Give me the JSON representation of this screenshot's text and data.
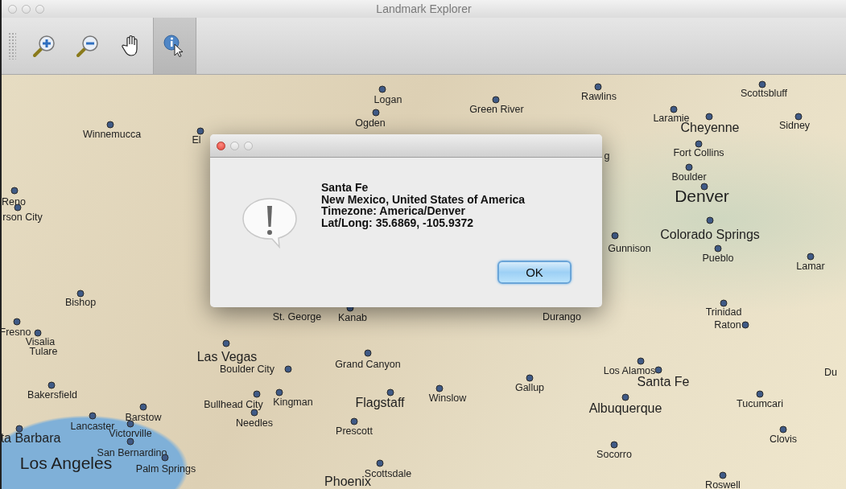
{
  "window": {
    "title": "Landmark Explorer",
    "active": false
  },
  "toolbar": {
    "tools": [
      {
        "kind": "zoom-in",
        "selected": false
      },
      {
        "kind": "zoom-out",
        "selected": false
      },
      {
        "kind": "pan",
        "selected": false
      },
      {
        "kind": "info",
        "selected": true
      }
    ]
  },
  "map": {
    "landmarks": [
      {
        "name": "Logan",
        "kind": "minor"
      },
      {
        "name": "Ogden",
        "kind": "minor"
      },
      {
        "name": "Green River",
        "kind": "minor"
      },
      {
        "name": "Rawlins",
        "kind": "minor"
      },
      {
        "name": "Scottsbluff",
        "kind": "minor"
      },
      {
        "name": "Laramie",
        "kind": "minor"
      },
      {
        "name": "Cheyenne",
        "kind": "major"
      },
      {
        "name": "Sidney",
        "kind": "minor"
      },
      {
        "name": "Fort Collins",
        "kind": "minor"
      },
      {
        "name": "Boulder",
        "kind": "minor"
      },
      {
        "name": "Denver",
        "kind": "capital"
      },
      {
        "name": "Colorado Springs",
        "kind": "major"
      },
      {
        "name": "Pueblo",
        "kind": "minor"
      },
      {
        "name": "Lamar",
        "kind": "minor"
      },
      {
        "name": "g",
        "kind": "minor"
      },
      {
        "name": "Gunnison",
        "kind": "minor"
      },
      {
        "name": "Winnemucca",
        "kind": "minor"
      },
      {
        "name": "El",
        "kind": "minor"
      },
      {
        "name": "Reno",
        "kind": "minor"
      },
      {
        "name": "rson City",
        "kind": "minor"
      },
      {
        "name": "Bishop",
        "kind": "minor"
      },
      {
        "name": "Fresno",
        "kind": "minor"
      },
      {
        "name": "Visalia",
        "kind": "minor"
      },
      {
        "name": "Tulare",
        "kind": "minor"
      },
      {
        "name": "Bakersfield",
        "kind": "minor"
      },
      {
        "name": "Barstow",
        "kind": "minor"
      },
      {
        "name": "Lancaster",
        "kind": "minor"
      },
      {
        "name": "Victorville",
        "kind": "minor"
      },
      {
        "name": "ta Barbara",
        "kind": "major"
      },
      {
        "name": "San Bernardino",
        "kind": "minor"
      },
      {
        "name": "Los Angeles",
        "kind": "capital"
      },
      {
        "name": "Palm Springs",
        "kind": "minor"
      },
      {
        "name": "St. George",
        "kind": "minor"
      },
      {
        "name": "Kanab",
        "kind": "minor"
      },
      {
        "name": "Durango",
        "kind": "minor"
      },
      {
        "name": "Las Vegas",
        "kind": "major"
      },
      {
        "name": "Boulder City",
        "kind": "minor"
      },
      {
        "name": "Grand Canyon",
        "kind": "minor"
      },
      {
        "name": "Bullhead City",
        "kind": "minor"
      },
      {
        "name": "Kingman",
        "kind": "minor"
      },
      {
        "name": "Needles",
        "kind": "minor"
      },
      {
        "name": "Flagstaff",
        "kind": "major"
      },
      {
        "name": "Winslow",
        "kind": "minor"
      },
      {
        "name": "Prescott",
        "kind": "minor"
      },
      {
        "name": "Scottsdale",
        "kind": "minor"
      },
      {
        "name": "Phoenix",
        "kind": "major"
      },
      {
        "name": "Gallup",
        "kind": "minor"
      },
      {
        "name": "Los Alamos",
        "kind": "minor"
      },
      {
        "name": "Santa Fe",
        "kind": "major"
      },
      {
        "name": "Albuquerque",
        "kind": "major"
      },
      {
        "name": "Trinidad",
        "kind": "minor"
      },
      {
        "name": "Raton",
        "kind": "minor"
      },
      {
        "name": "Tucumcari",
        "kind": "minor"
      },
      {
        "name": "Clovis",
        "kind": "minor"
      },
      {
        "name": "Socorro",
        "kind": "minor"
      },
      {
        "name": "Roswell",
        "kind": "minor"
      },
      {
        "name": "Du",
        "kind": "minor"
      }
    ]
  },
  "dialog": {
    "active": true,
    "lines": [
      "Santa Fe",
      "New Mexico, United States of America",
      "Timezone: America/Denver",
      "Lat/Long: 35.6869, -105.9372"
    ],
    "button": {
      "label": "OK",
      "default": true
    }
  }
}
